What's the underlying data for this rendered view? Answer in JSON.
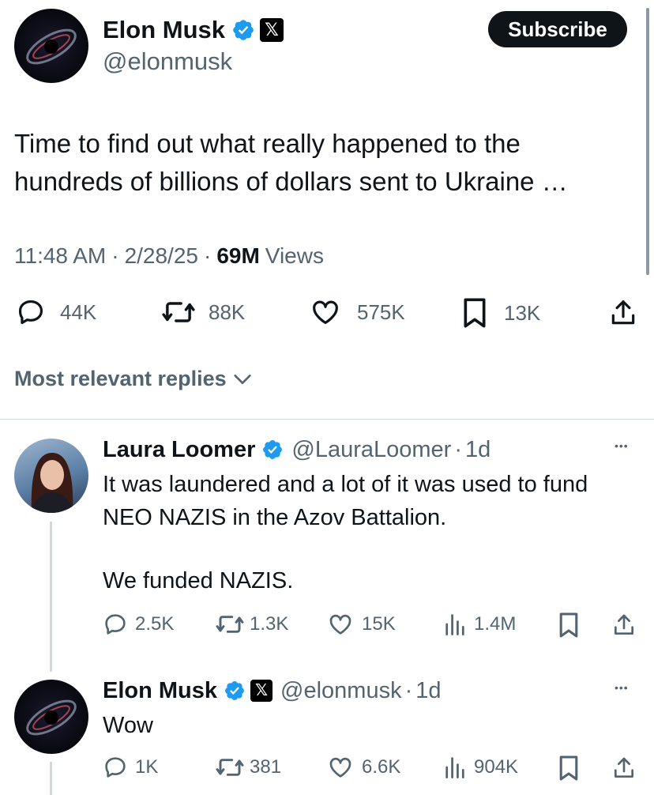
{
  "main_tweet": {
    "author_name": "Elon Musk",
    "author_handle": "@elonmusk",
    "x_badge": "𝕏",
    "subscribe_label": "Subscribe",
    "text": "Time to find out what really happened to the hundreds of billions of dollars sent to Ukraine …",
    "time": "11:48 AM",
    "date": "2/28/25",
    "views_count": "69M",
    "views_label": "Views",
    "sep": "·",
    "replies": "44K",
    "reposts": "88K",
    "likes": "575K",
    "bookmarks": "13K"
  },
  "replies_sort": {
    "label": "Most relevant replies"
  },
  "reply1": {
    "author_name": "Laura Loomer",
    "author_handle": "@LauraLoomer",
    "sep": "·",
    "age": "1d",
    "more": "•••",
    "text_line1": "It was laundered and a lot of it was used to fund",
    "text_line2": "NEO NAZIS in the Azov Battalion.",
    "text_line3": "We funded NAZIS.",
    "replies": "2.5K",
    "reposts": "1.3K",
    "likes": "15K",
    "views": "1.4M"
  },
  "reply2": {
    "author_name": "Elon Musk",
    "author_handle": "@elonmusk",
    "x_badge": "𝕏",
    "sep": "·",
    "age": "1d",
    "more": "•••",
    "text": "Wow",
    "replies": "1K",
    "reposts": "381",
    "likes": "6.6K",
    "views": "904K"
  },
  "colors": {
    "verified_blue": "#1d9bf0",
    "text_primary": "#0f1419",
    "text_secondary": "#536471",
    "divider": "#cfd9de"
  }
}
